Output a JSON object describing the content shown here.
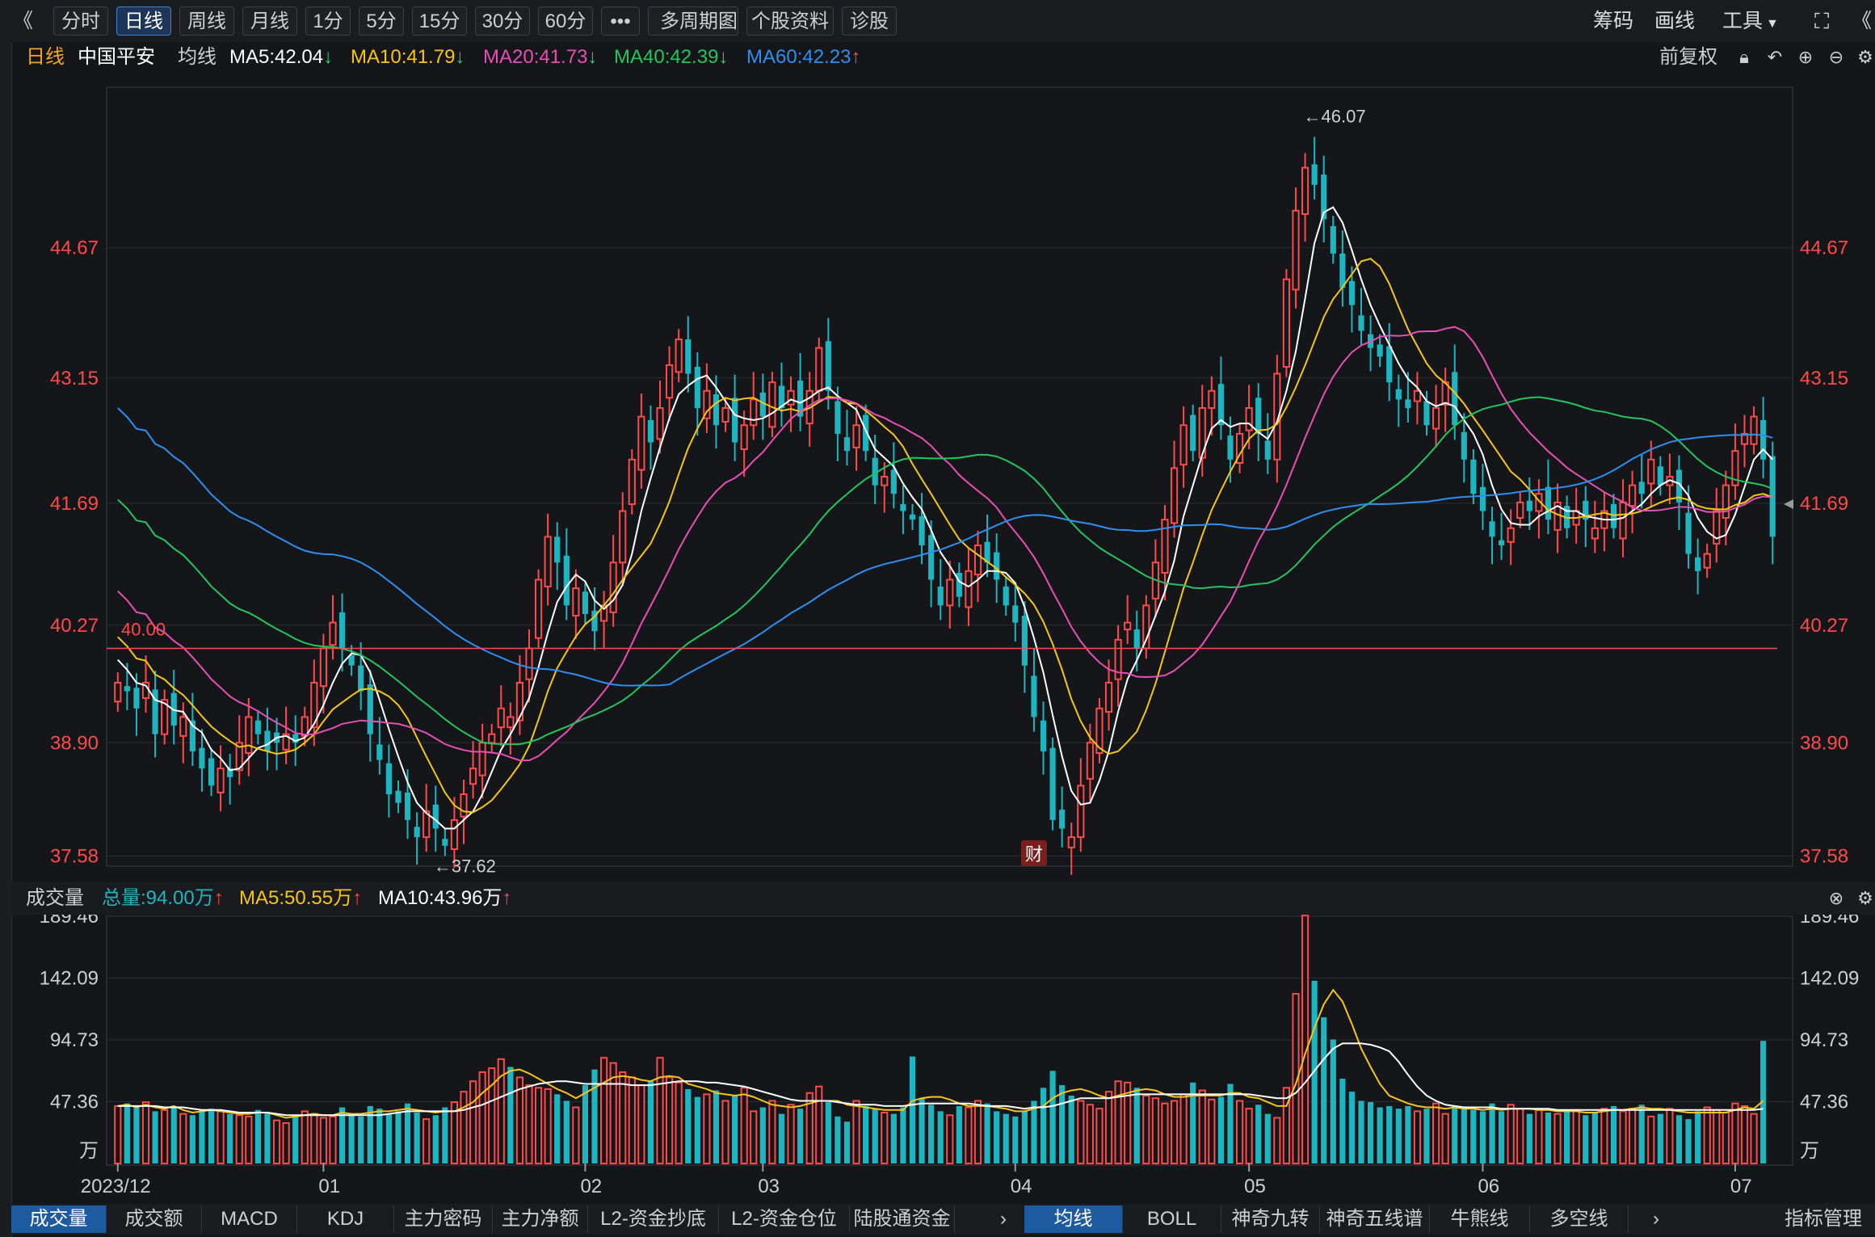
{
  "toolbar": {
    "collapse_glyph": "《",
    "expand_glyph": "《",
    "buttons": [
      {
        "label": "分时",
        "active": false
      },
      {
        "label": "日线",
        "active": true
      },
      {
        "label": "周线",
        "active": false
      },
      {
        "label": "月线",
        "active": false
      },
      {
        "label": "1分",
        "active": false
      },
      {
        "label": "5分",
        "active": false
      },
      {
        "label": "15分",
        "active": false
      },
      {
        "label": "30分",
        "active": false
      },
      {
        "label": "60分",
        "active": false
      },
      {
        "label": "•••",
        "active": false
      },
      {
        "label": "多周期图",
        "active": false
      },
      {
        "label": "个股资料",
        "active": false
      },
      {
        "label": "诊股",
        "active": false
      }
    ],
    "right_items": [
      "筹码",
      "画线",
      "工具"
    ]
  },
  "kline_header": {
    "period": "日线",
    "stock_name": "中国平安",
    "indicator": "均线",
    "ma5": "MA5:42.04",
    "ma10": "MA10:41.79",
    "ma20": "MA20:41.73",
    "ma40": "MA40:42.39",
    "ma60": "MA60:42.23",
    "ma5_dir": "↓",
    "ma10_dir": "↓",
    "ma20_dir": "↓",
    "ma40_dir": "↓",
    "ma60_dir": "↑",
    "adjust": "前复权"
  },
  "colors": {
    "up": "#ff4a4a",
    "down": "#1fb5c0",
    "ma5": "#ffffff",
    "ma10": "#f5c518",
    "ma20": "#e84fb5",
    "ma40": "#22c55e",
    "ma60": "#2d8ff0"
  },
  "chart_data": {
    "type": "candlestick",
    "price_axis_ticks": [
      "44.67",
      "43.15",
      "41.69",
      "40.27",
      "38.90",
      "37.58"
    ],
    "price_axis_values": [
      44.67,
      43.15,
      41.69,
      40.27,
      38.9,
      37.58
    ],
    "price_range": [
      37.5,
      46.5
    ],
    "high_annotation": "←46.07",
    "low_annotation": "←37.62",
    "reference_line": {
      "label": "40.00",
      "value": 40.0
    },
    "finance_marker": "财",
    "x_labels": [
      "2023/12",
      "01",
      "02",
      "03",
      "04",
      "05",
      "06",
      "07"
    ],
    "x_label_index": [
      0,
      22,
      50,
      69,
      96,
      121,
      146,
      173
    ],
    "closes": [
      39.6,
      39.5,
      39.3,
      39.6,
      39.0,
      39.4,
      39.1,
      39.2,
      38.8,
      38.6,
      38.4,
      38.6,
      38.5,
      38.9,
      39.2,
      39.0,
      38.8,
      38.9,
      39.0,
      38.9,
      39.2,
      39.6,
      40.0,
      40.3,
      40.0,
      39.8,
      39.5,
      39.0,
      38.7,
      38.3,
      38.2,
      38.0,
      37.8,
      38.1,
      37.9,
      37.7,
      38.0,
      38.3,
      38.6,
      38.9,
      39.0,
      39.3,
      39.2,
      39.6,
      40.0,
      40.8,
      41.3,
      41.0,
      40.5,
      40.7,
      40.4,
      40.2,
      40.5,
      41.0,
      41.6,
      42.2,
      42.7,
      42.4,
      42.8,
      43.3,
      43.6,
      43.2,
      42.8,
      43.0,
      42.6,
      42.8,
      42.4,
      42.6,
      42.9,
      42.7,
      43.1,
      42.8,
      43.0,
      42.7,
      43.0,
      43.5,
      43.0,
      42.5,
      42.3,
      42.6,
      42.3,
      41.9,
      42.0,
      41.8,
      41.6,
      41.5,
      41.2,
      40.8,
      40.5,
      40.8,
      40.6,
      40.9,
      41.2,
      41.0,
      40.8,
      40.5,
      40.3,
      39.8,
      39.2,
      38.8,
      38.0,
      37.9,
      37.8,
      38.4,
      38.9,
      39.3,
      39.6,
      40.1,
      40.3,
      40.0,
      40.5,
      41.0,
      41.5,
      42.1,
      42.6,
      42.3,
      42.8,
      43.0,
      42.6,
      42.2,
      42.5,
      42.8,
      42.5,
      42.2,
      43.2,
      44.3,
      45.1,
      45.6,
      45.4,
      45.0,
      44.6,
      44.2,
      44.0,
      43.7,
      43.5,
      43.4,
      43.1,
      42.9,
      42.8,
      43.0,
      42.6,
      42.8,
      43.1,
      42.6,
      42.2,
      41.8,
      41.6,
      41.3,
      41.2,
      41.4,
      41.7,
      41.6,
      41.8,
      41.5,
      41.7,
      41.4,
      41.6,
      41.5,
      41.4,
      41.6,
      41.4,
      41.7,
      41.9,
      41.8,
      42.2,
      41.9,
      42.0,
      41.7,
      41.1,
      40.9,
      41.1,
      41.6,
      41.9,
      42.3,
      42.5,
      42.7,
      42.2,
      41.3
    ],
    "volume_axis_ticks": [
      "189.46",
      "142.09",
      "94.73",
      "47.36",
      "万"
    ],
    "volume_axis_values": [
      189.46,
      142.09,
      94.73,
      47.36
    ],
    "volume_max": 189.46,
    "volumes": [
      44,
      46,
      43,
      47,
      40,
      41,
      44,
      38,
      37,
      41,
      42,
      40,
      38,
      37,
      36,
      41,
      39,
      33,
      31,
      36,
      40,
      38,
      35,
      36,
      43,
      37,
      36,
      44,
      42,
      38,
      40,
      46,
      39,
      34,
      37,
      43,
      47,
      55,
      63,
      70,
      73,
      80,
      74,
      66,
      60,
      58,
      57,
      53,
      48,
      43,
      60,
      72,
      81,
      77,
      70,
      66,
      60,
      63,
      81,
      66,
      62,
      57,
      51,
      53,
      56,
      48,
      52,
      58,
      40,
      43,
      48,
      38,
      45,
      42,
      54,
      59,
      47,
      36,
      32,
      48,
      44,
      42,
      39,
      38,
      43,
      82,
      50,
      45,
      40,
      37,
      44,
      43,
      48,
      46,
      40,
      38,
      36,
      40,
      48,
      58,
      71,
      60,
      52,
      48,
      45,
      42,
      55,
      63,
      62,
      58,
      52,
      50,
      46,
      48,
      53,
      62,
      56,
      49,
      51,
      61,
      48,
      42,
      45,
      38,
      35,
      58,
      130,
      190,
      140,
      112,
      95,
      65,
      55,
      48,
      47,
      43,
      44,
      42,
      44,
      40,
      42,
      46,
      38,
      44,
      42,
      41,
      40,
      46,
      40,
      45,
      42,
      38,
      41,
      39,
      38,
      40,
      41,
      37,
      39,
      42,
      44,
      40,
      42,
      45,
      36,
      38,
      42,
      37,
      34,
      40,
      43,
      41,
      39,
      46,
      44,
      38,
      94
    ],
    "volume_ma5": [
      44,
      45,
      43,
      45,
      43,
      42,
      44,
      41,
      39,
      40,
      41,
      40,
      39,
      38,
      38,
      39,
      39,
      37,
      35,
      36,
      37,
      38,
      37,
      37,
      39,
      38,
      38,
      39,
      40,
      40,
      41,
      42,
      41,
      40,
      39,
      40,
      40,
      43,
      47,
      54,
      60,
      67,
      71,
      72,
      69,
      65,
      61,
      57,
      54,
      50,
      54,
      58,
      62,
      66,
      67,
      66,
      64,
      63,
      66,
      67,
      66,
      61,
      59,
      57,
      54,
      53,
      52,
      53,
      51,
      48,
      45,
      44,
      43,
      44,
      46,
      48,
      48,
      48,
      45,
      44,
      43,
      42,
      41,
      41,
      41,
      48,
      50,
      51,
      51,
      49,
      46,
      44,
      44,
      44,
      43,
      42,
      40,
      40,
      42,
      44,
      50,
      54,
      56,
      57,
      55,
      52,
      50,
      52,
      54,
      56,
      57,
      56,
      53,
      51,
      51,
      52,
      52,
      52,
      52,
      54,
      54,
      51,
      50,
      47,
      44,
      44,
      61,
      84,
      104,
      122,
      133,
      124,
      107,
      88,
      74,
      61,
      52,
      49,
      46,
      44,
      43,
      43,
      42,
      43,
      42,
      42,
      41,
      42,
      41,
      42,
      42,
      42,
      41,
      41,
      40,
      40,
      40,
      39,
      39,
      40,
      41,
      41,
      42,
      43,
      42,
      42,
      41,
      40,
      39,
      39,
      39,
      39,
      39,
      41,
      43,
      42,
      48
    ],
    "volume_ma10": [
      44,
      44,
      44,
      44,
      44,
      43,
      43,
      43,
      42,
      41,
      41,
      41,
      40,
      39,
      39,
      39,
      39,
      38,
      37,
      37,
      37,
      37,
      37,
      37,
      37,
      37,
      37,
      37,
      37,
      38,
      39,
      40,
      40,
      40,
      40,
      40,
      40,
      41,
      43,
      45,
      48,
      51,
      54,
      57,
      59,
      61,
      62,
      63,
      63,
      62,
      61,
      61,
      61,
      61,
      61,
      60,
      60,
      60,
      61,
      62,
      63,
      63,
      63,
      62,
      62,
      61,
      60,
      59,
      57,
      55,
      53,
      51,
      49,
      48,
      48,
      48,
      48,
      47,
      46,
      45,
      45,
      45,
      44,
      44,
      44,
      45,
      46,
      46,
      46,
      46,
      46,
      46,
      45,
      44,
      44,
      44,
      43,
      42,
      43,
      43,
      44,
      46,
      48,
      50,
      50,
      50,
      50,
      51,
      52,
      53,
      53,
      53,
      53,
      53,
      53,
      53,
      53,
      53,
      53,
      53,
      53,
      53,
      52,
      51,
      50,
      50,
      54,
      62,
      71,
      80,
      88,
      92,
      92,
      92,
      91,
      89,
      86,
      78,
      68,
      59,
      52,
      48,
      45,
      44,
      43,
      43,
      43,
      43,
      42,
      42,
      42,
      42,
      42,
      42,
      41,
      41,
      41,
      41,
      41,
      41,
      41,
      41,
      41,
      41,
      41,
      41,
      41,
      41,
      41,
      41,
      41,
      41,
      41,
      41,
      41,
      41,
      42
    ],
    "total_volume": "总量:94.00万",
    "vol_ma5": "MA5:50.55万",
    "vol_ma10": "MA10:43.96万"
  },
  "volume_header": {
    "label": "成交量",
    "total": "总量:94.00万",
    "ma5": "MA5:50.55万",
    "ma10": "MA10:43.96万",
    "total_dir": "↑",
    "ma5_dir": "↑",
    "ma10_dir": "↑"
  },
  "bottom_tabs_left": [
    {
      "label": "成交量",
      "active": true
    },
    {
      "label": "成交额",
      "active": false
    },
    {
      "label": "MACD",
      "active": false
    },
    {
      "label": "KDJ",
      "active": false
    },
    {
      "label": "主力密码",
      "active": false
    },
    {
      "label": "主力净额",
      "active": false
    },
    {
      "label": "L2-资金抄底",
      "active": false
    },
    {
      "label": "L2-资金仓位",
      "active": false
    },
    {
      "label": "陆股通资金",
      "active": false
    }
  ],
  "bottom_tabs_right": [
    {
      "label": "均线",
      "active": true
    },
    {
      "label": "BOLL",
      "active": false
    },
    {
      "label": "神奇九转",
      "active": false
    },
    {
      "label": "神奇五线谱",
      "active": false
    },
    {
      "label": "牛熊线",
      "active": false
    },
    {
      "label": "多空线",
      "active": false
    }
  ],
  "indicator_manage": "指标管理"
}
